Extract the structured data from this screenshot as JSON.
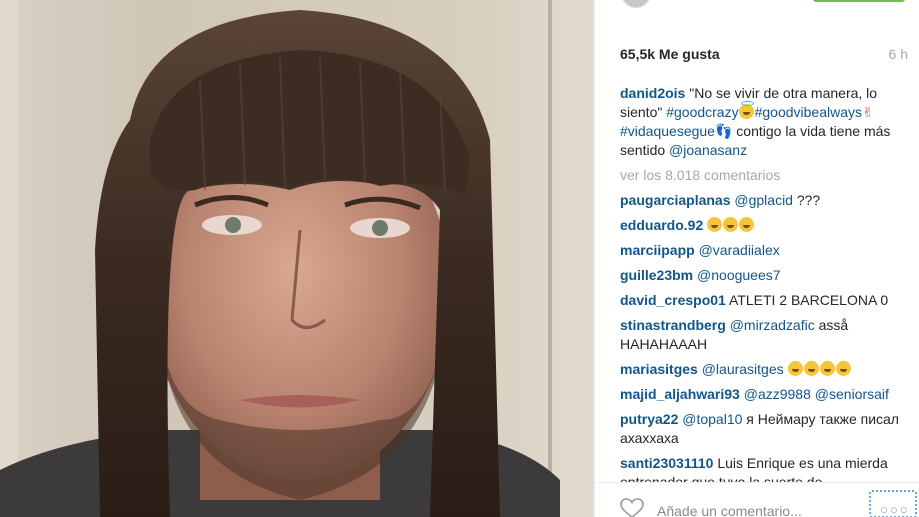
{
  "post": {
    "likes": "65,5k Me gusta",
    "time": "6 h"
  },
  "caption": {
    "user": "danid2ois",
    "text1": "\"No se vivir de otra manera, lo siento\" ",
    "tag1": "#goodcrazy",
    "tag2": "#goodvibealways",
    "tag3": "#vidaquesegue",
    "text2": " contigo la vida tiene más sentido ",
    "mention": "@joanasanz",
    "sym_hands": "✌",
    "sym_feet": "👣"
  },
  "view_comments": "ver los 8.018 comentarios",
  "comments": [
    {
      "user": "paugarciaplanas",
      "mention": "@gplacid",
      "text": " ???"
    },
    {
      "user": "edduardo.92",
      "text": ""
    },
    {
      "user": "marciipapp",
      "mention": "@varadiialex",
      "text": ""
    },
    {
      "user": "guille23bm",
      "mention": "@nooguees7",
      "text": ""
    },
    {
      "user": "david_crespo01",
      "text": "ATLETI 2 BARCELONA 0"
    },
    {
      "user": "stinastrandberg",
      "mention": "@mirzadzafic",
      "text": " asså HAHAHAAAH"
    },
    {
      "user": "mariasitges",
      "mention": "@laurasitges",
      "text": ""
    },
    {
      "user": "majid_aljahwari93",
      "mention": "@azz9988",
      "mention2": "@seniorsaif",
      "text": ""
    },
    {
      "user": "putrya22",
      "mention": "@topal10",
      "text": " я Неймару также писал ахаххаха"
    },
    {
      "user": "santi23031110",
      "text": "Luis Enrique es una mierda entrenador que tuvo la suerte de"
    }
  ],
  "footer": {
    "placeholder": "Añade un comentario...",
    "more_dots": "○○○"
  },
  "colors": {
    "link": "#125688",
    "meta": "#a5a7aa",
    "follow": "#70c050"
  }
}
